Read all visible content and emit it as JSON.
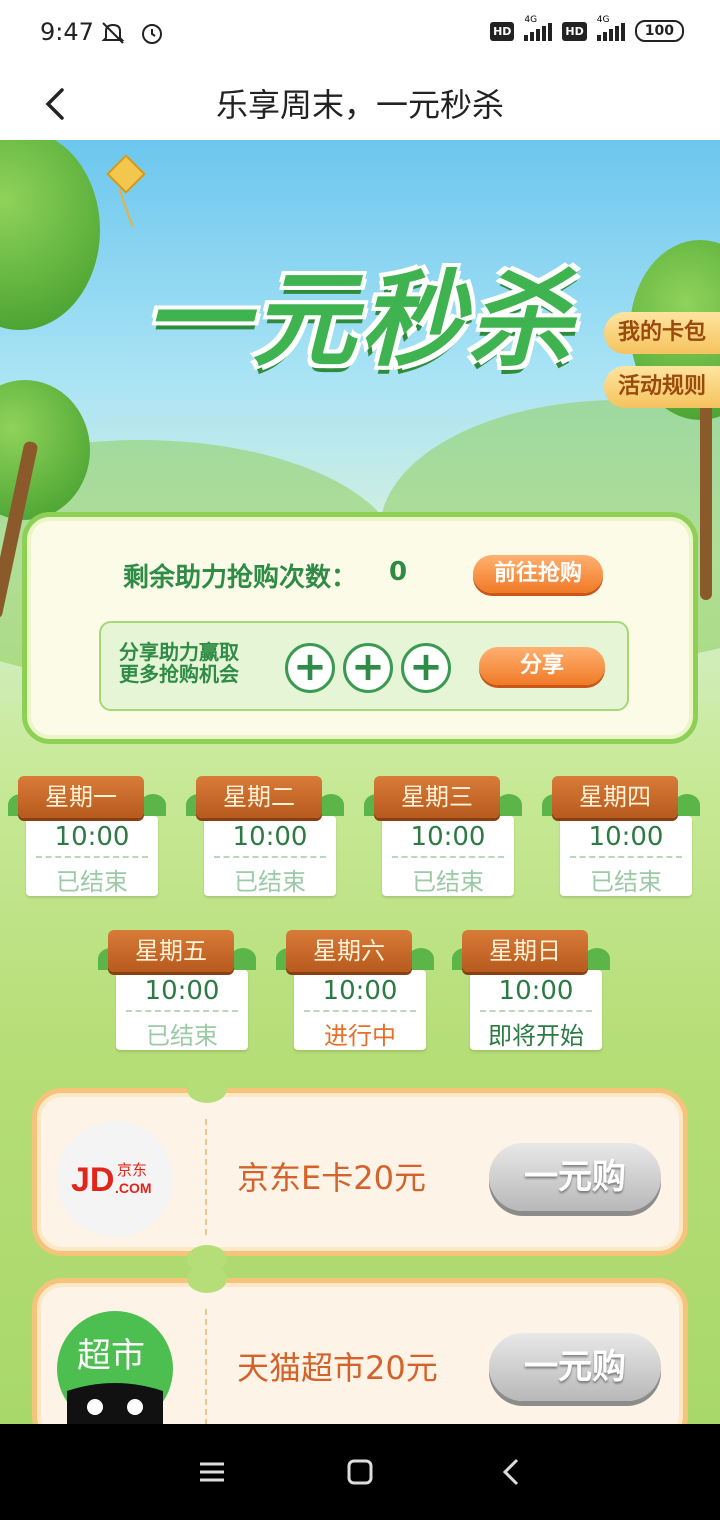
{
  "status": {
    "time": "9:47",
    "hd": "HD",
    "net": "4G",
    "battery": "100"
  },
  "nav": {
    "title": "乐享周末，一元秒杀"
  },
  "hero": {
    "title": "一元秒杀"
  },
  "side": {
    "wallet": "我的卡包",
    "rules": "活动规则"
  },
  "panel": {
    "remain_label": "剩余助力抢购次数：",
    "remain_count": "0",
    "go_buy": "前往抢购",
    "share_line1": "分享助力赢取",
    "share_line2": "更多抢购机会",
    "share": "分享",
    "plus": "+"
  },
  "days": [
    {
      "name": "星期一",
      "time": "10:00",
      "status": "已结束"
    },
    {
      "name": "星期二",
      "time": "10:00",
      "status": "已结束"
    },
    {
      "name": "星期三",
      "time": "10:00",
      "status": "已结束"
    },
    {
      "name": "星期四",
      "time": "10:00",
      "status": "已结束"
    },
    {
      "name": "星期五",
      "time": "10:00",
      "status": "已结束"
    },
    {
      "name": "星期六",
      "time": "10:00",
      "status": "进行中"
    },
    {
      "name": "星期日",
      "time": "10:00",
      "status": "即将开始"
    }
  ],
  "products": [
    {
      "logo_text": "JD",
      "logo_sub": "京东",
      "logo_sub2": ".COM",
      "name": "京东E卡20元",
      "btn": "一元购"
    },
    {
      "logo_text": "超市",
      "name": "天猫超市20元",
      "btn": "一元购"
    }
  ]
}
